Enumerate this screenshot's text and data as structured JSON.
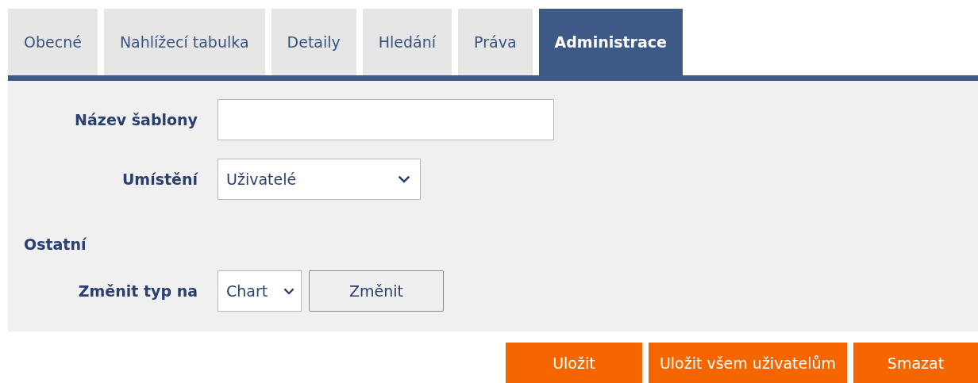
{
  "tabs": [
    {
      "label": "Obecné",
      "selected": false
    },
    {
      "label": "Nahlížecí tabulka",
      "selected": false
    },
    {
      "label": "Detaily",
      "selected": false
    },
    {
      "label": "Hledání",
      "selected": false
    },
    {
      "label": "Práva",
      "selected": false
    },
    {
      "label": "Administrace",
      "selected": true
    }
  ],
  "form": {
    "template_name": {
      "label": "Název šablony"
    },
    "location": {
      "label": "Umístění",
      "value": "Uživatelé"
    },
    "section_title": "Ostatní",
    "change_type": {
      "label": "Změnit typ na",
      "value": "Chart",
      "button": "Změnit"
    }
  },
  "buttons": [
    "Uložit",
    "Uložit všem uživatelům",
    "Smazat"
  ]
}
